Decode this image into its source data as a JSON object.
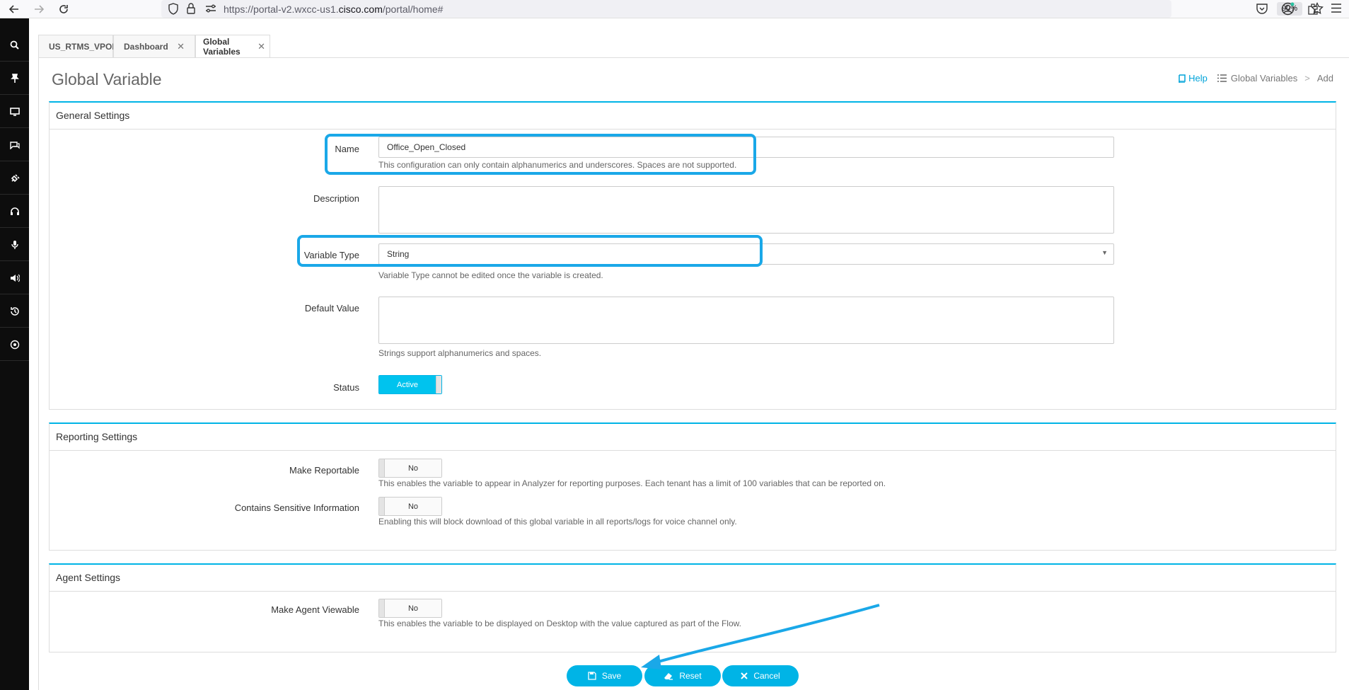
{
  "browser": {
    "url_prefix": "https://portal-v2.wxcc-us1.",
    "url_domain": "cisco.com",
    "url_suffix": "/portal/home#",
    "zoom": "90%"
  },
  "tabs": [
    {
      "label": "US_RTMS_VPOP"
    },
    {
      "label": "Dashboard"
    },
    {
      "label": "Global Variables"
    }
  ],
  "page": {
    "title": "Global Variable",
    "help_label": "Help",
    "crumb_parent": "Global Variables",
    "crumb_sep": ">",
    "crumb_current": "Add"
  },
  "general": {
    "heading": "General Settings",
    "name_label": "Name",
    "name_value": "Office_Open_Closed",
    "name_hint": "This configuration can only contain alphanumerics and underscores. Spaces are not supported.",
    "description_label": "Description",
    "description_value": "",
    "type_label": "Variable Type",
    "type_value": "String",
    "type_hint": "Variable Type cannot be edited once the variable is created.",
    "default_label": "Default Value",
    "default_value": "",
    "default_hint": "Strings support alphanumerics and spaces.",
    "status_label": "Status",
    "status_value": "Active"
  },
  "reporting": {
    "heading": "Reporting Settings",
    "reportable_label": "Make Reportable",
    "reportable_value": "No",
    "reportable_hint": "This enables the variable to appear in Analyzer for reporting purposes. Each tenant has a limit of 100 variables that can be reported on.",
    "sensitive_label": "Contains Sensitive Information",
    "sensitive_value": "No",
    "sensitive_hint": "Enabling this will block download of this global variable in all reports/logs for voice channel only."
  },
  "agent": {
    "heading": "Agent Settings",
    "viewable_label": "Make Agent Viewable",
    "viewable_value": "No",
    "viewable_hint": "This enables the variable to be displayed on Desktop with the value captured as part of the Flow."
  },
  "actions": {
    "save": "Save",
    "reset": "Reset",
    "cancel": "Cancel"
  },
  "colors": {
    "accent": "#00b4e6",
    "annotation": "#1aa8e8",
    "rail": "#0d0d0d"
  }
}
